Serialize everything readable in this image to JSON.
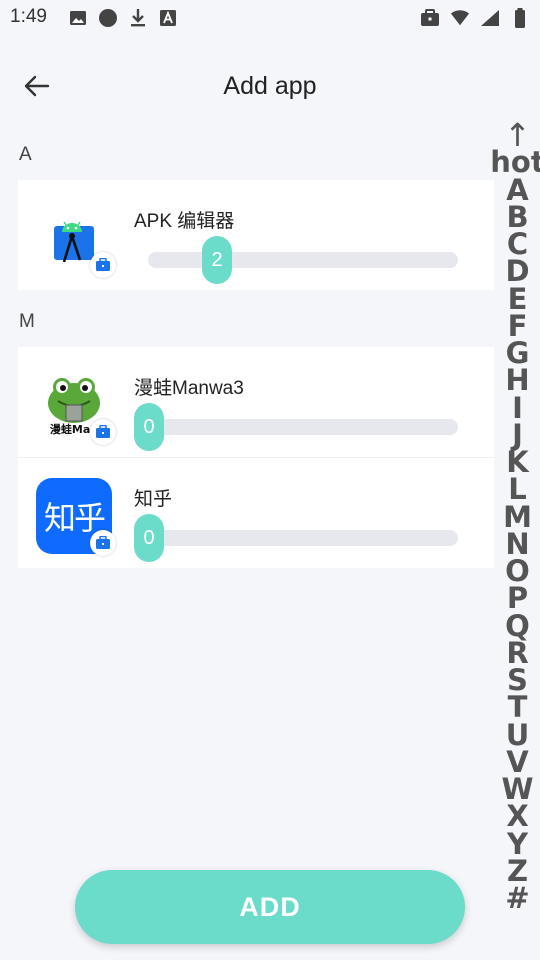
{
  "status_bar": {
    "time": "1:49",
    "left_icons": [
      "image-icon",
      "circle-icon",
      "download-icon",
      "text-a-icon"
    ],
    "right_icons": [
      "briefcase-icon",
      "wifi-icon",
      "signal-icon",
      "battery-icon"
    ]
  },
  "header": {
    "back_icon": "arrow-left-icon",
    "title": "Add app"
  },
  "sections": [
    {
      "letter": "A",
      "apps": [
        {
          "name": "APK 编辑器",
          "value": "2",
          "icon": "apk-editor-icon"
        }
      ]
    },
    {
      "letter": "M",
      "apps": [
        {
          "name": "漫蛙Manwa3",
          "value": "0",
          "icon": "manwa-frog-icon",
          "icon_text": "漫蛙Man"
        },
        {
          "name": "知乎",
          "value": "0",
          "icon": "zhihu-icon",
          "icon_text": "知乎"
        }
      ]
    }
  ],
  "index_bar": [
    "↑",
    "hot",
    "A",
    "B",
    "C",
    "D",
    "E",
    "F",
    "G",
    "H",
    "I",
    "J",
    "K",
    "L",
    "M",
    "N",
    "O",
    "P",
    "Q",
    "R",
    "S",
    "T",
    "U",
    "V",
    "W",
    "X",
    "Y",
    "Z",
    "#"
  ],
  "add_button": {
    "label": "ADD"
  },
  "colors": {
    "accent": "#6adcc9",
    "background": "#f5f6fa",
    "track": "#e7e8ee",
    "zhihu_blue": "#0f6bff",
    "badge_blue": "#1a73e8"
  }
}
